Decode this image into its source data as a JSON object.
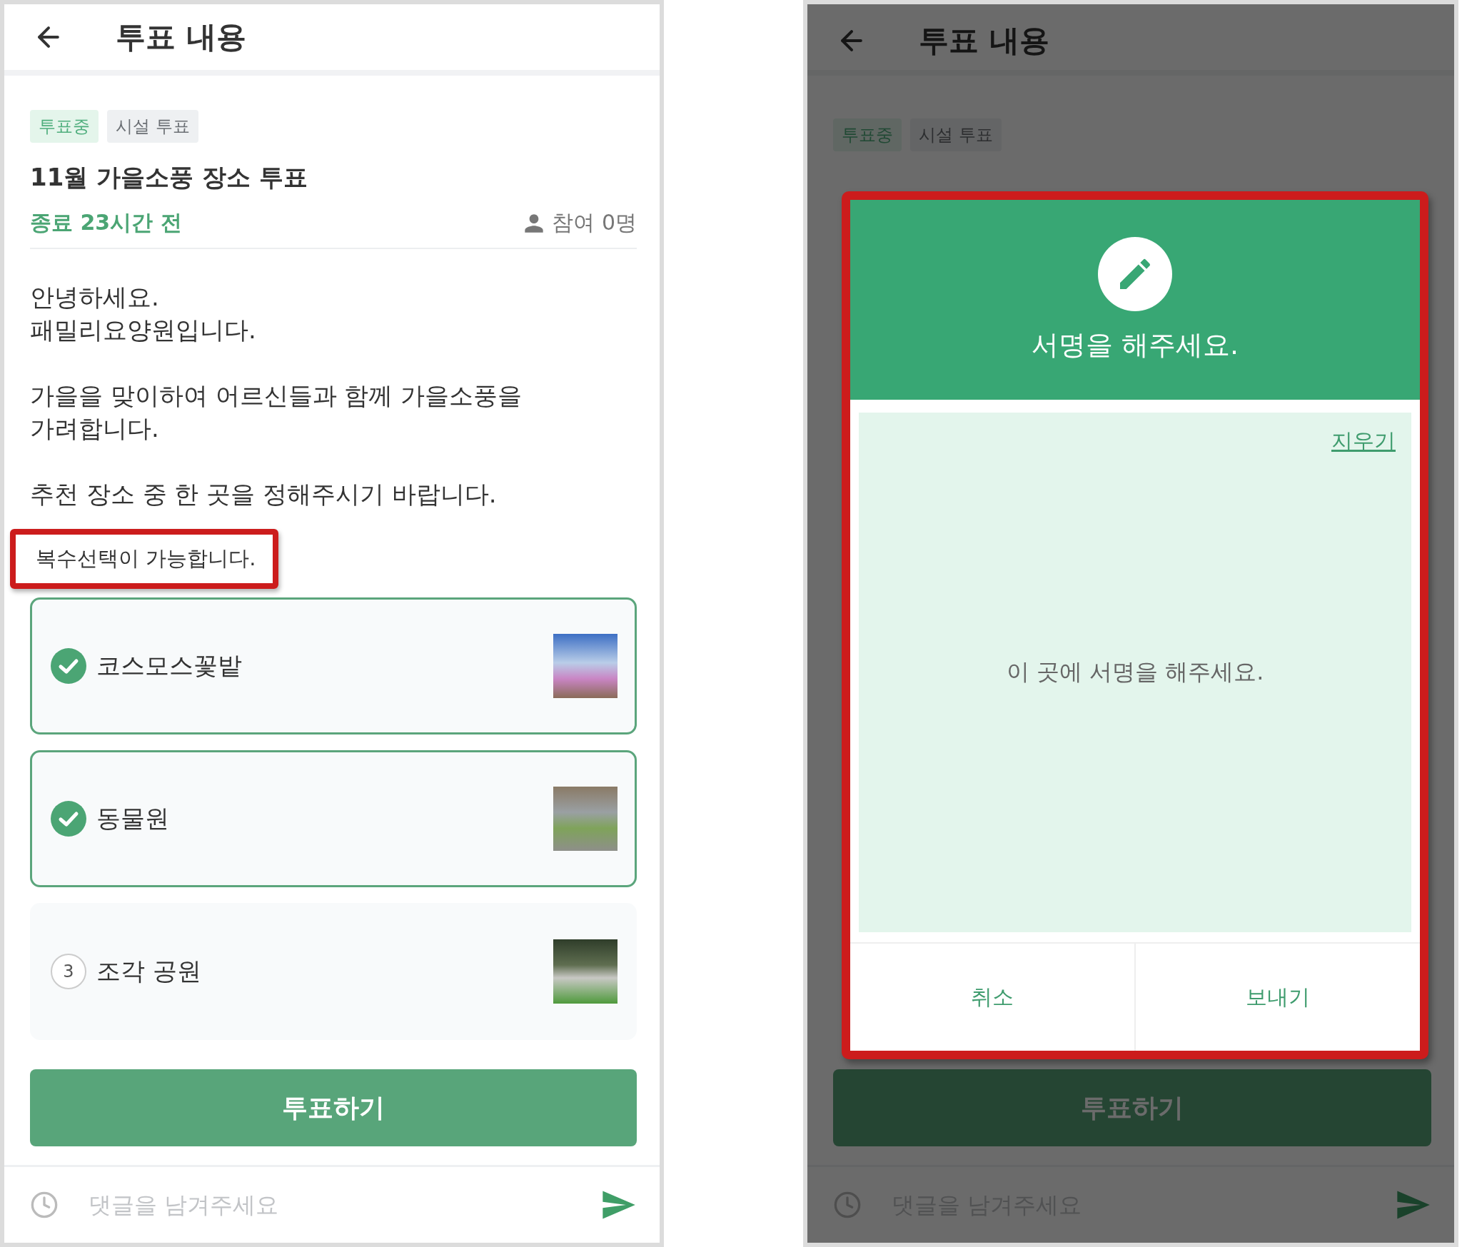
{
  "left_screen": {
    "header": {
      "title": "투표 내용"
    },
    "tags": [
      {
        "label": "투표중",
        "kind": "status"
      },
      {
        "label": "시설 투표",
        "kind": "category"
      }
    ],
    "poll": {
      "title": "11월 가을소풍 장소 투표",
      "deadline": "종료 23시간 전",
      "participants": "참여 0명"
    },
    "body": [
      "안녕하세요.\n패밀리요양원입니다.",
      "가을을 맞이하여 어르신들과 함께 가을소풍을\n가려합니다.",
      "추천 장소 중 한 곳을 정해주시기 바랍니다."
    ],
    "note": {
      "text": "복수선택이 가능합니다.",
      "highlighted": true
    },
    "options": [
      {
        "label": "코스모스꽃밭",
        "selected": true
      },
      {
        "label": "동물원",
        "selected": true
      },
      {
        "label": "조각 공원",
        "selected": false,
        "number": "3"
      }
    ],
    "vote_button": "투표하기",
    "comment": {
      "placeholder": "댓글을 남겨주세요"
    }
  },
  "right_screen": {
    "header": {
      "title": "투표 내용"
    },
    "tags": [
      {
        "label": "투표중",
        "kind": "status"
      },
      {
        "label": "시설 투표",
        "kind": "category"
      }
    ],
    "vote_button": "투표하기",
    "comment": {
      "placeholder": "댓글을 남겨주세요"
    },
    "dimmed": true,
    "dialog": {
      "title": "서명을 해주세요.",
      "clear_link": "지우기",
      "placeholder": "이 곳에 서명을 해주세요.",
      "buttons": [
        "취소",
        "보내기"
      ],
      "highlighted": true
    }
  }
}
